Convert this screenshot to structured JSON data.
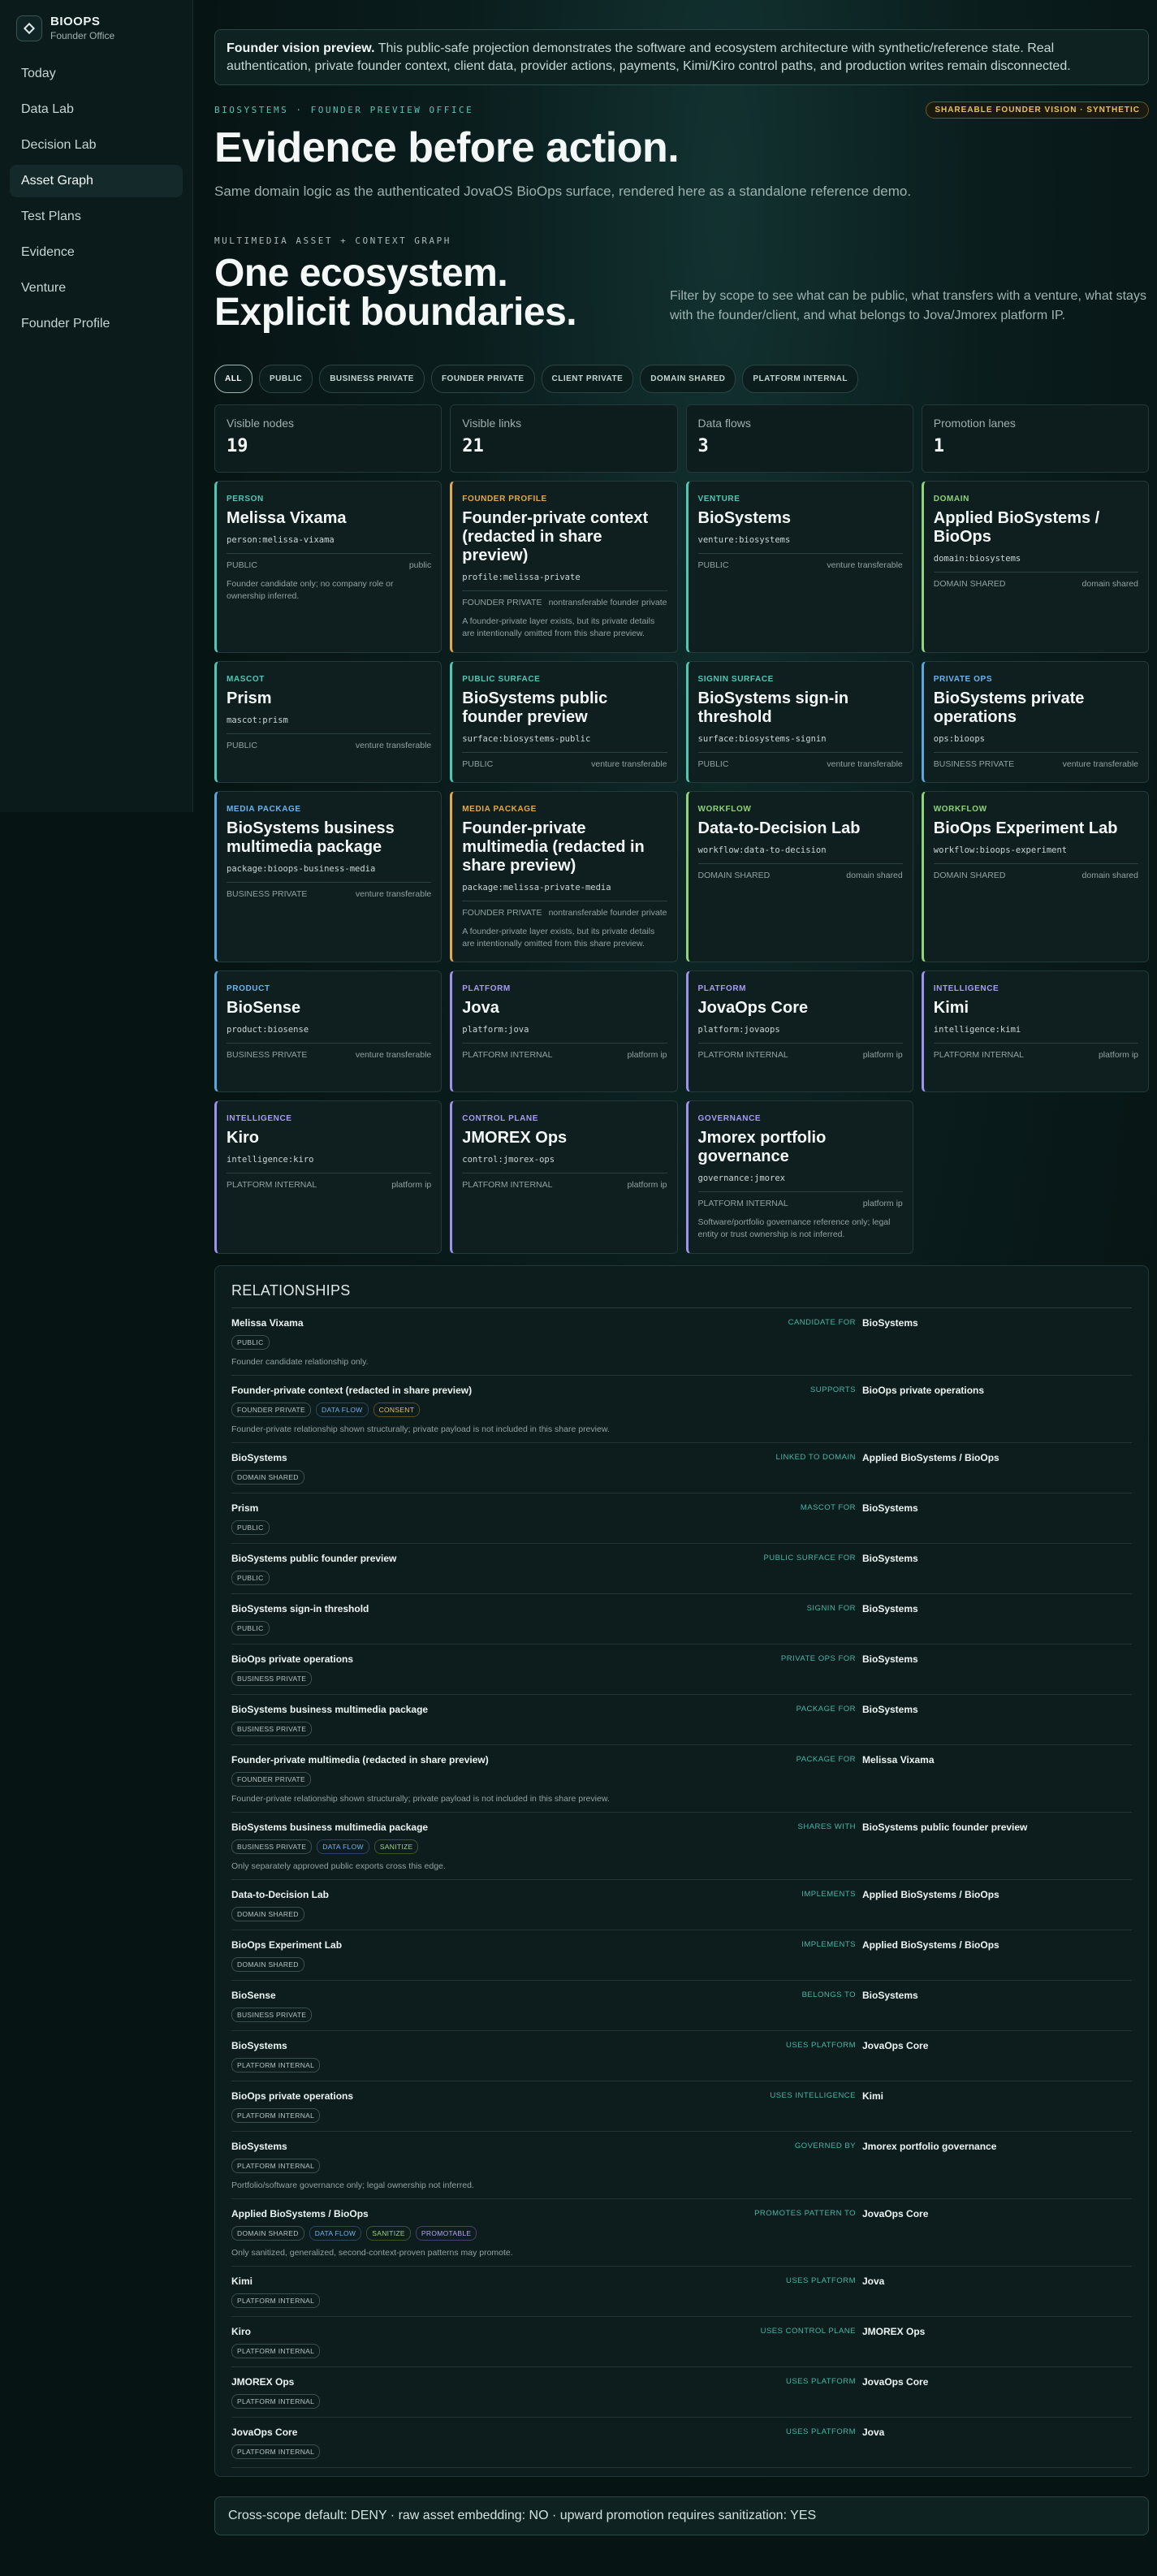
{
  "brand": {
    "name": "BIOOPS",
    "subtitle": "Founder Office"
  },
  "nav": [
    "Today",
    "Data Lab",
    "Decision Lab",
    "Asset Graph",
    "Test Plans",
    "Evidence",
    "Venture",
    "Founder Profile"
  ],
  "banner": {
    "lead": "Founder vision preview.",
    "text": " This public-safe projection demonstrates the software and ecosystem architecture with synthetic/reference state. Real authentication, private founder context, client data, provider actions, payments, Kimi/Kiro control paths, and production writes remain disconnected."
  },
  "hero": {
    "eyebrow": "BIOSYSTEMS · FOUNDER PREVIEW OFFICE",
    "badge": "SHAREABLE FOUNDER VISION · SYNTHETIC",
    "title": "Evidence before action.",
    "subtitle": "Same domain logic as the authenticated JovaOS BioOps surface, rendered here as a standalone reference demo."
  },
  "ecosystem": {
    "eyebrow": "MULTIMEDIA ASSET + CONTEXT GRAPH",
    "title_line1": "One ecosystem.",
    "title_line2": "Explicit boundaries.",
    "description": "Filter by scope to see what can be public, what transfers with a venture, what stays with the founder/client, and what belongs to Jova/Jmorex platform IP."
  },
  "filters": [
    "ALL",
    "PUBLIC",
    "BUSINESS PRIVATE",
    "FOUNDER PRIVATE",
    "CLIENT PRIVATE",
    "DOMAIN SHARED",
    "PLATFORM INTERNAL"
  ],
  "stats": [
    {
      "label": "Visible nodes",
      "value": "19"
    },
    {
      "label": "Visible links",
      "value": "21"
    },
    {
      "label": "Data flows",
      "value": "3"
    },
    {
      "label": "Promotion lanes",
      "value": "1"
    }
  ],
  "cards": [
    {
      "kind": "PERSON",
      "tone": "public",
      "title": "Melissa Vixama",
      "id": "person:melissa-vixama",
      "scope": "PUBLIC",
      "transfer": "public",
      "note": "Founder candidate only; no company role or ownership inferred."
    },
    {
      "kind": "FOUNDER PROFILE",
      "tone": "founder",
      "title": "Founder-private context (redacted in share preview)",
      "id": "profile:melissa-private",
      "scope": "FOUNDER PRIVATE",
      "transfer": "nontransferable founder private",
      "note": "A founder-private layer exists, but its private details are intentionally omitted from this share preview."
    },
    {
      "kind": "VENTURE",
      "tone": "public",
      "title": "BioSystems",
      "id": "venture:biosystems",
      "scope": "PUBLIC",
      "transfer": "venture transferable",
      "note": ""
    },
    {
      "kind": "DOMAIN",
      "tone": "domain",
      "title": "Applied BioSystems / BioOps",
      "id": "domain:biosystems",
      "scope": "DOMAIN SHARED",
      "transfer": "domain shared",
      "note": ""
    },
    {
      "kind": "MASCOT",
      "tone": "public",
      "title": "Prism",
      "id": "mascot:prism",
      "scope": "PUBLIC",
      "transfer": "venture transferable",
      "note": ""
    },
    {
      "kind": "PUBLIC SURFACE",
      "tone": "public",
      "title": "BioSystems public founder preview",
      "id": "surface:biosystems-public",
      "scope": "PUBLIC",
      "transfer": "venture transferable",
      "note": ""
    },
    {
      "kind": "SIGNIN SURFACE",
      "tone": "public",
      "title": "BioSystems sign-in threshold",
      "id": "surface:biosystems-signin",
      "scope": "PUBLIC",
      "transfer": "venture transferable",
      "note": ""
    },
    {
      "kind": "PRIVATE OPS",
      "tone": "business",
      "title": "BioSystems private operations",
      "id": "ops:bioops",
      "scope": "BUSINESS PRIVATE",
      "transfer": "venture transferable",
      "note": ""
    },
    {
      "kind": "MEDIA PACKAGE",
      "tone": "business",
      "title": "BioSystems business multimedia package",
      "id": "package:bioops-business-media",
      "scope": "BUSINESS PRIVATE",
      "transfer": "venture transferable",
      "note": ""
    },
    {
      "kind": "MEDIA PACKAGE",
      "tone": "founder",
      "title": "Founder-private multimedia (redacted in share preview)",
      "id": "package:melissa-private-media",
      "scope": "FOUNDER PRIVATE",
      "transfer": "nontransferable founder private",
      "note": "A founder-private layer exists, but its private details are intentionally omitted from this share preview."
    },
    {
      "kind": "WORKFLOW",
      "tone": "domain",
      "title": "Data-to-Decision Lab",
      "id": "workflow:data-to-decision",
      "scope": "DOMAIN SHARED",
      "transfer": "domain shared",
      "note": ""
    },
    {
      "kind": "WORKFLOW",
      "tone": "domain",
      "title": "BioOps Experiment Lab",
      "id": "workflow:bioops-experiment",
      "scope": "DOMAIN SHARED",
      "transfer": "domain shared",
      "note": ""
    },
    {
      "kind": "PRODUCT",
      "tone": "business",
      "title": "BioSense",
      "id": "product:biosense",
      "scope": "BUSINESS PRIVATE",
      "transfer": "venture transferable",
      "note": ""
    },
    {
      "kind": "PLATFORM",
      "tone": "platform",
      "title": "Jova",
      "id": "platform:jova",
      "scope": "PLATFORM INTERNAL",
      "transfer": "platform ip",
      "note": ""
    },
    {
      "kind": "PLATFORM",
      "tone": "platform",
      "title": "JovaOps Core",
      "id": "platform:jovaops",
      "scope": "PLATFORM INTERNAL",
      "transfer": "platform ip",
      "note": ""
    },
    {
      "kind": "INTELLIGENCE",
      "tone": "platform",
      "title": "Kimi",
      "id": "intelligence:kimi",
      "scope": "PLATFORM INTERNAL",
      "transfer": "platform ip",
      "note": ""
    },
    {
      "kind": "INTELLIGENCE",
      "tone": "platform",
      "title": "Kiro",
      "id": "intelligence:kiro",
      "scope": "PLATFORM INTERNAL",
      "transfer": "platform ip",
      "note": ""
    },
    {
      "kind": "CONTROL PLANE",
      "tone": "platform",
      "title": "JMOREX Ops",
      "id": "control:jmorex-ops",
      "scope": "PLATFORM INTERNAL",
      "transfer": "platform ip",
      "note": ""
    },
    {
      "kind": "GOVERNANCE",
      "tone": "platform",
      "title": "Jmorex portfolio governance",
      "id": "governance:jmorex",
      "scope": "PLATFORM INTERNAL",
      "transfer": "platform ip",
      "note": "Software/portfolio governance reference only; legal entity or trust ownership is not inferred."
    }
  ],
  "relationships_title": "RELATIONSHIPS",
  "relationships": [
    {
      "source": "Melissa Vixama",
      "verb": "CANDIDATE FOR",
      "target": "BioSystems",
      "tags": [
        "PUBLIC"
      ],
      "note": "Founder candidate relationship only."
    },
    {
      "source": "Founder-private context (redacted in share preview)",
      "verb": "SUPPORTS",
      "target": "BioOps private operations",
      "tags": [
        "FOUNDER PRIVATE",
        "DATA FLOW",
        "CONSENT"
      ],
      "note": "Founder-private relationship shown structurally; private payload is not included in this share preview."
    },
    {
      "source": "BioSystems",
      "verb": "LINKED TO DOMAIN",
      "target": "Applied BioSystems / BioOps",
      "tags": [
        "DOMAIN SHARED"
      ],
      "note": ""
    },
    {
      "source": "Prism",
      "verb": "MASCOT FOR",
      "target": "BioSystems",
      "tags": [
        "PUBLIC"
      ],
      "note": ""
    },
    {
      "source": "BioSystems public founder preview",
      "verb": "PUBLIC SURFACE FOR",
      "target": "BioSystems",
      "tags": [
        "PUBLIC"
      ],
      "note": ""
    },
    {
      "source": "BioSystems sign-in threshold",
      "verb": "SIGNIN FOR",
      "target": "BioSystems",
      "tags": [
        "PUBLIC"
      ],
      "note": ""
    },
    {
      "source": "BioOps private operations",
      "verb": "PRIVATE OPS FOR",
      "target": "BioSystems",
      "tags": [
        "BUSINESS PRIVATE"
      ],
      "note": ""
    },
    {
      "source": "BioSystems business multimedia package",
      "verb": "PACKAGE FOR",
      "target": "BioSystems",
      "tags": [
        "BUSINESS PRIVATE"
      ],
      "note": ""
    },
    {
      "source": "Founder-private multimedia (redacted in share preview)",
      "verb": "PACKAGE FOR",
      "target": "Melissa Vixama",
      "tags": [
        "FOUNDER PRIVATE"
      ],
      "note": "Founder-private relationship shown structurally; private payload is not included in this share preview."
    },
    {
      "source": "BioSystems business multimedia package",
      "verb": "SHARES WITH",
      "target": "BioSystems public founder preview",
      "tags": [
        "BUSINESS PRIVATE",
        "DATA FLOW",
        "SANITIZE"
      ],
      "note": "Only separately approved public exports cross this edge."
    },
    {
      "source": "Data-to-Decision Lab",
      "verb": "IMPLEMENTS",
      "target": "Applied BioSystems / BioOps",
      "tags": [
        "DOMAIN SHARED"
      ],
      "note": ""
    },
    {
      "source": "BioOps Experiment Lab",
      "verb": "IMPLEMENTS",
      "target": "Applied BioSystems / BioOps",
      "tags": [
        "DOMAIN SHARED"
      ],
      "note": ""
    },
    {
      "source": "BioSense",
      "verb": "BELONGS TO",
      "target": "BioSystems",
      "tags": [
        "BUSINESS PRIVATE"
      ],
      "note": ""
    },
    {
      "source": "BioSystems",
      "verb": "USES PLATFORM",
      "target": "JovaOps Core",
      "tags": [
        "PLATFORM INTERNAL"
      ],
      "note": ""
    },
    {
      "source": "BioOps private operations",
      "verb": "USES INTELLIGENCE",
      "target": "Kimi",
      "tags": [
        "PLATFORM INTERNAL"
      ],
      "note": ""
    },
    {
      "source": "BioSystems",
      "verb": "GOVERNED BY",
      "target": "Jmorex portfolio governance",
      "tags": [
        "PLATFORM INTERNAL"
      ],
      "note": "Portfolio/software governance only; legal ownership not inferred."
    },
    {
      "source": "Applied BioSystems / BioOps",
      "verb": "PROMOTES PATTERN TO",
      "target": "JovaOps Core",
      "tags": [
        "DOMAIN SHARED",
        "DATA FLOW",
        "SANITIZE",
        "PROMOTABLE"
      ],
      "note": "Only sanitized, generalized, second-context-proven patterns may promote."
    },
    {
      "source": "Kimi",
      "verb": "USES PLATFORM",
      "target": "Jova",
      "tags": [
        "PLATFORM INTERNAL"
      ],
      "note": ""
    },
    {
      "source": "Kiro",
      "verb": "USES CONTROL PLANE",
      "target": "JMOREX Ops",
      "tags": [
        "PLATFORM INTERNAL"
      ],
      "note": ""
    },
    {
      "source": "JMOREX Ops",
      "verb": "USES PLATFORM",
      "target": "JovaOps Core",
      "tags": [
        "PLATFORM INTERNAL"
      ],
      "note": ""
    },
    {
      "source": "JovaOps Core",
      "verb": "USES PLATFORM",
      "target": "Jova",
      "tags": [
        "PLATFORM INTERNAL"
      ],
      "note": ""
    }
  ],
  "footer": "Cross-scope default: DENY · raw asset embedding: NO · upward promotion requires sanitization: YES"
}
